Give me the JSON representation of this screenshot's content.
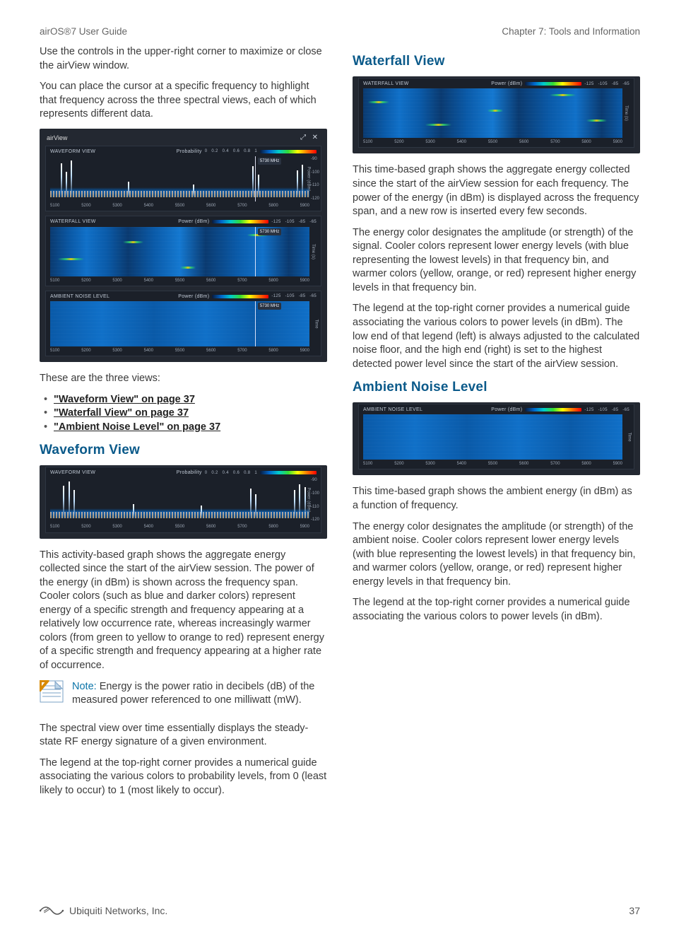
{
  "header": {
    "left": "airOS®7 User Guide",
    "right": "Chapter 7: Tools and Information"
  },
  "left": {
    "p1": "Use the controls in the upper-right corner to maximize or close the airView window.",
    "p2": "You can place the cursor at a specific frequency to highlight that frequency across the three spectral views, each of which represents different data.",
    "views_intro": "These are the three views:",
    "views": [
      {
        "label": "\"Waveform View\" on page 37"
      },
      {
        "label": "\"Waterfall View\" on page 37"
      },
      {
        "label": "\"Ambient Noise Level\" on page 37"
      }
    ],
    "h_waveform": "Waveform View",
    "wave_p1": "This activity-based graph shows the aggregate energy collected since the start of the airView session. The power of the energy (in dBm) is shown across the frequency span. Cooler colors (such as blue and darker colors) represent energy of a specific strength and frequency appearing at a relatively low occurrence rate, whereas increasingly warmer colors (from green to yellow to orange to red) represent energy of a specific strength and frequency appearing at a higher rate of occurrence.",
    "note_label": "Note: ",
    "note_body": "Energy is the power ratio in decibels (dB) of the measured power referenced to one milliwatt (mW).",
    "wave_p2": "The spectral view over time essentially displays the steady-state RF energy signature of a given environment.",
    "wave_p3": "The legend at the top-right corner provides a numerical guide associating the various colors to probability levels, from 0 (least likely to occur) to 1 (most likely to occur)."
  },
  "right": {
    "h_waterfall": "Waterfall View",
    "wf_p1": "This time-based graph shows the aggregate energy collected since the start of the airView session for each frequency. The power of the energy (in dBm) is displayed across the frequency span, and a new row is inserted every few seconds.",
    "wf_p2": "The energy color designates the amplitude (or strength) of the signal. Cooler colors represent lower energy levels (with blue representing the lowest levels) in that frequency bin, and warmer colors (yellow, orange, or red) represent higher energy levels in that frequency bin.",
    "wf_p3": "The legend at the top-right corner provides a numerical guide associating the various colors to power levels (in dBm). The low end of that legend (left) is always adjusted to the calculated noise floor, and the high end (right) is set to the highest detected power level since the start of the airView session.",
    "h_ambient": "Ambient Noise Level",
    "amb_p1": "This time-based graph shows the ambient energy (in dBm) as a function of frequency.",
    "amb_p2": "The energy color designates the amplitude (or strength) of the ambient noise. Cooler colors represent lower energy levels (with blue representing the lowest levels) in that frequency bin, and warmer colors (yellow, orange, or red) represent higher energy levels in that frequency bin.",
    "amb_p3": "The legend at the top-right corner provides a numerical guide associating the various colors to power levels (in dBm)."
  },
  "fig_main": {
    "window_title": "airView",
    "panels": {
      "waveform": {
        "title": "WAVEFORM VIEW",
        "legend_label": "Probability",
        "legend_ticks": [
          "0",
          "0.2",
          "0.4",
          "0.6",
          "0.8",
          "1"
        ],
        "cursor_freq": "5730 MHz",
        "yaxis_label": "Power (dBm)",
        "yticks": [
          "-90",
          "-100",
          "-110",
          "-120"
        ]
      },
      "waterfall": {
        "title": "WATERFALL VIEW",
        "legend_label": "Power (dBm)",
        "legend_ticks": [
          "-125",
          "-105",
          "-85",
          "-65"
        ],
        "cursor_freq": "5730 MHz",
        "yaxis_label": "Time (s)"
      },
      "ambient": {
        "title": "AMBIENT NOISE LEVEL",
        "legend_label": "Power (dBm)",
        "legend_ticks": [
          "-125",
          "-105",
          "-85",
          "-65"
        ],
        "cursor_freq": "5730 MHz",
        "yaxis_label": "Time"
      }
    },
    "xticks": [
      "5100",
      "5200",
      "5300",
      "5400",
      "5500",
      "5600",
      "5700",
      "5800",
      "5900"
    ]
  },
  "fig_wave_only": {
    "title": "WAVEFORM VIEW",
    "legend_label": "Probability",
    "legend_ticks": [
      "0",
      "0.2",
      "0.4",
      "0.6",
      "0.8",
      "1"
    ],
    "yaxis_label": "Power (dBm)",
    "yticks": [
      "-90",
      "-100",
      "-110",
      "-120"
    ],
    "xticks": [
      "5100",
      "5200",
      "5300",
      "5400",
      "5500",
      "5600",
      "5700",
      "5800",
      "5900"
    ]
  },
  "fig_waterfall_only": {
    "title": "WATERFALL VIEW",
    "legend_label": "Power (dBm)",
    "legend_ticks": [
      "-125",
      "-105",
      "-85",
      "-65"
    ],
    "yaxis_label": "Time (s)",
    "xticks": [
      "5100",
      "5200",
      "5300",
      "5400",
      "5500",
      "5600",
      "5700",
      "5800",
      "5900"
    ]
  },
  "fig_ambient_only": {
    "title": "AMBIENT NOISE LEVEL",
    "legend_label": "Power (dBm)",
    "legend_ticks": [
      "-125",
      "-105",
      "-85",
      "-65"
    ],
    "yaxis_label": "Time",
    "xticks": [
      "5100",
      "5200",
      "5300",
      "5400",
      "5500",
      "5600",
      "5700",
      "5800",
      "5900"
    ]
  },
  "footer": {
    "brand": "Ubiquiti Networks, Inc.",
    "page": "37"
  }
}
